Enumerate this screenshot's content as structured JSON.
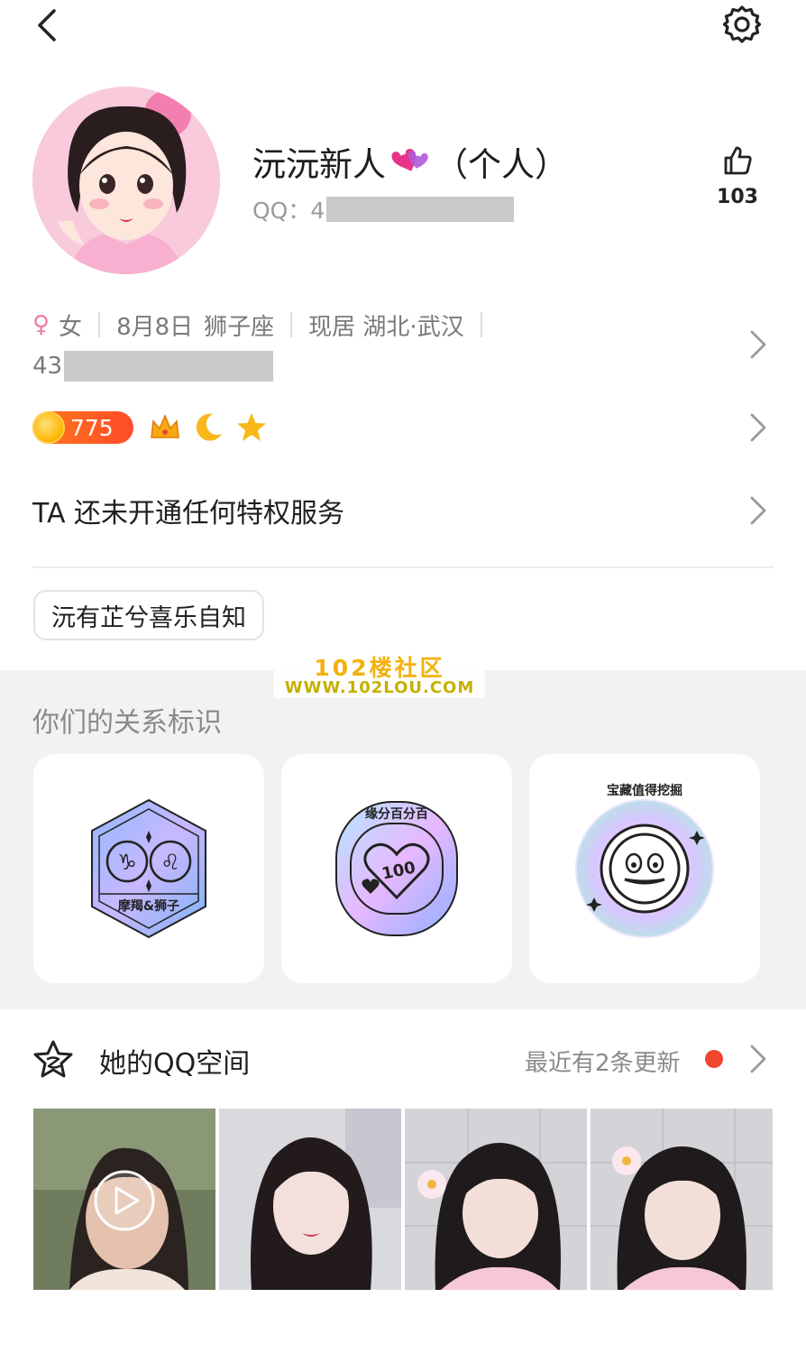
{
  "profile": {
    "nickname": "沅沅新人",
    "nickname_suffix": "（个人）",
    "qq_label": "QQ：4",
    "likes": "103"
  },
  "info": {
    "gender": "女",
    "birthday": "8月8日",
    "zodiac": "狮子座",
    "residence": "现居 湖北·武汉",
    "id_prefix": "43"
  },
  "level": {
    "value": "775",
    "icons": [
      "crown-icon",
      "moon-icon",
      "star-icon"
    ]
  },
  "privilege": {
    "text": "TA 还未开通任何特权服务"
  },
  "signature": {
    "text": "沅有芷兮喜乐自知"
  },
  "watermark": {
    "line1": "102楼社区",
    "line2": "WWW.102LOU.COM"
  },
  "relationship": {
    "title": "你们的关系标识",
    "cards": [
      {
        "label": "摩羯&狮子",
        "icon": "zodiac-pair-badge"
      },
      {
        "label": "缘分百分百",
        "icon": "heart-100-badge"
      },
      {
        "label": "宝藏值得挖掘",
        "icon": "treasure-face-badge"
      }
    ]
  },
  "qzone": {
    "title": "她的QQ空间",
    "update_text": "最近有2条更新",
    "photos": [
      "video-thumbnail",
      "photo-2",
      "photo-3",
      "photo-4"
    ]
  },
  "colors": {
    "accent_red": "#f0462f",
    "level_orange": "#ff5a22",
    "gender_pink": "#f07aa7",
    "band_grey": "#f2f2f4"
  }
}
